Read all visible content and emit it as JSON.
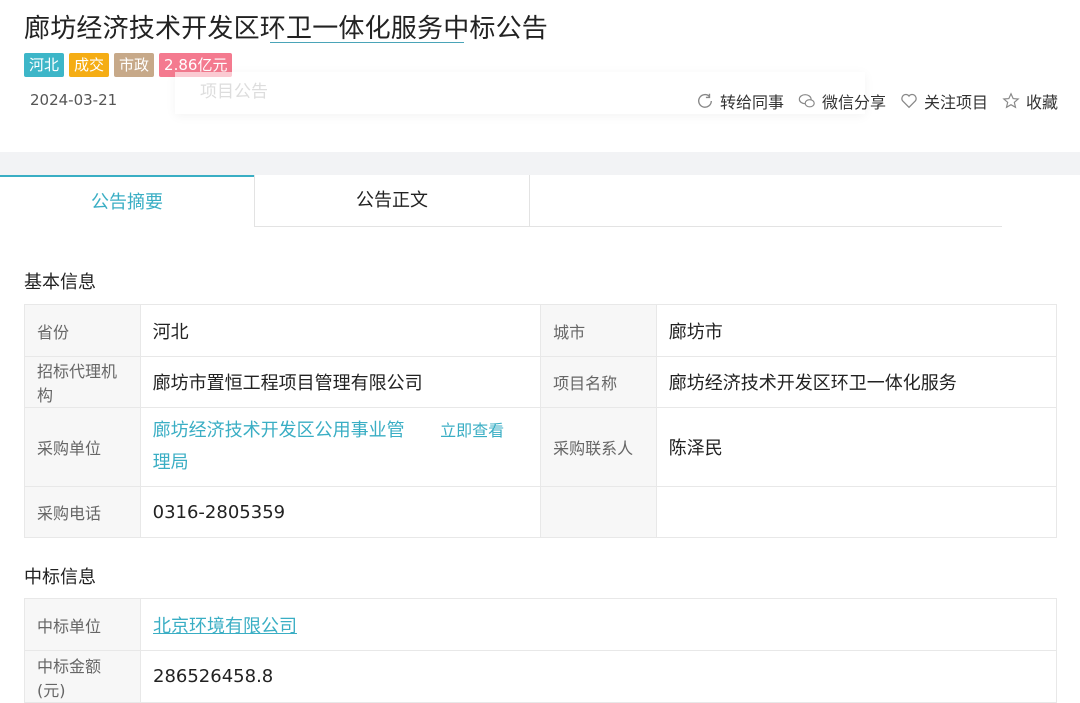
{
  "header": {
    "title": "廊坊经济技术开发区环卫一体化服务中标公告",
    "tags": [
      "河北",
      "成交",
      "市政",
      "2.86亿元"
    ],
    "date": "2024-03-21",
    "ghost_label": "项目公告"
  },
  "actions": [
    {
      "label": "转给同事",
      "icon": "share-refresh-icon"
    },
    {
      "label": "微信分享",
      "icon": "wechat-icon"
    },
    {
      "label": "关注项目",
      "icon": "heart-icon"
    },
    {
      "label": "收藏",
      "icon": "star-icon"
    }
  ],
  "tabs": [
    "公告摘要",
    "公告正文"
  ],
  "basic": {
    "heading": "基本信息",
    "province_label": "省份",
    "province": "河北",
    "city_label": "城市",
    "city": "廊坊市",
    "agency_label": "招标代理机构",
    "agency": "廊坊市置恒工程项目管理有限公司",
    "project_label": "项目名称",
    "project": "廊坊经济技术开发区环卫一体化服务",
    "buyer_label": "采购单位",
    "buyer_line1": "廊坊经济技术开发区公用事业管",
    "buyer_line2": "理局",
    "buyer_link": "立即查看",
    "contact_label": "采购联系人",
    "contact": "陈泽民",
    "phone_label": "采购电话",
    "phone": "0316-2805359"
  },
  "winner": {
    "heading": "中标信息",
    "unit_label": "中标单位",
    "unit": "北京环境有限公司",
    "amount_label": "中标金额(元)",
    "amount": "286526458.8"
  },
  "colors": {
    "accent": "#3aaec4",
    "tag_region": "#3db6c8",
    "tag_status": "#f5ad14",
    "tag_type": "#c7a989",
    "tag_amount": "#f47a8f"
  }
}
